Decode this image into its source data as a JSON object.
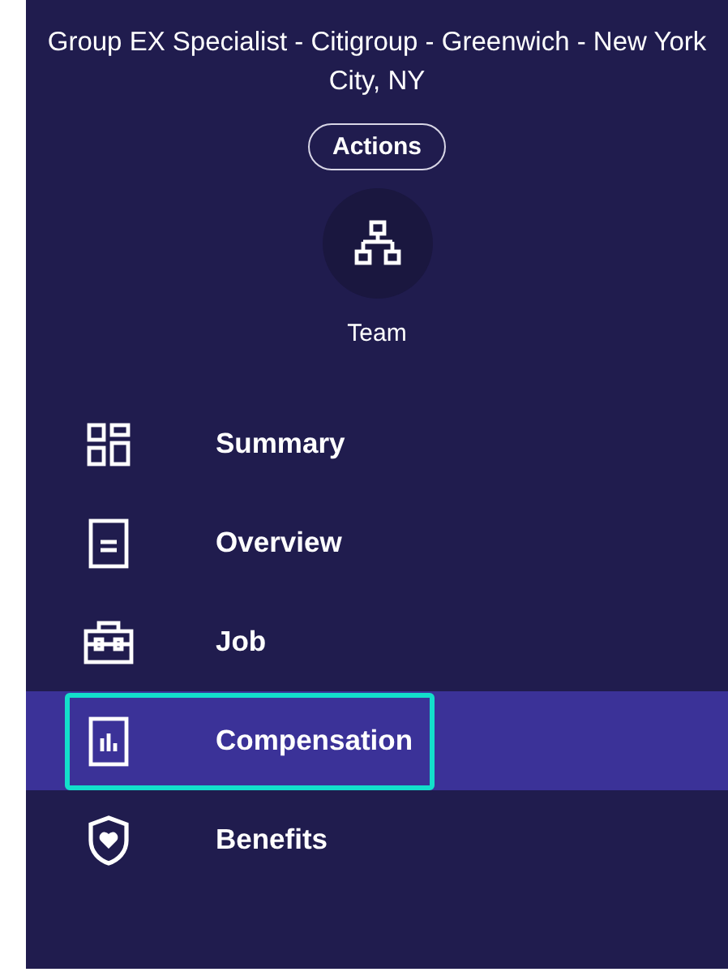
{
  "header": {
    "title": "Group EX Specialist - Citigroup - Greenwich - New York City, NY",
    "action_button": "Actions",
    "team": {
      "label": "Team"
    }
  },
  "nav": {
    "items": [
      {
        "label": "Summary",
        "kind": "summary",
        "selected": false,
        "focused": false
      },
      {
        "label": "Overview",
        "kind": "overview",
        "selected": false,
        "focused": false
      },
      {
        "label": "Job",
        "kind": "job",
        "selected": false,
        "focused": false
      },
      {
        "label": "Compensation",
        "kind": "compensation",
        "selected": true,
        "focused": true
      },
      {
        "label": "Benefits",
        "kind": "benefits",
        "selected": false,
        "focused": false
      }
    ]
  }
}
